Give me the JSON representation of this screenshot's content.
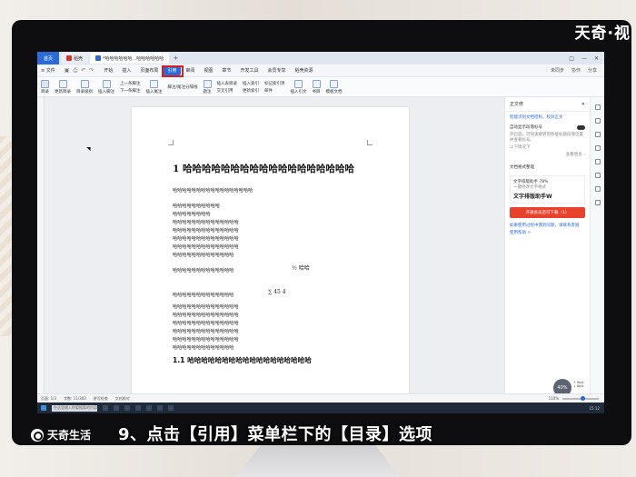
{
  "watermark": "天奇·视",
  "title_bar": {
    "home_tab": "首页",
    "wps_tab": "稻壳",
    "doc_tab": "*哈哈哈哈哈哈...哈哈哈哈哈哈",
    "new_tab": "+",
    "right_icons": [
      "□",
      "—",
      "✕"
    ]
  },
  "menu_bar": {
    "file": "≡ 文件",
    "items": [
      "开始",
      "插入",
      "页面布局",
      "引用",
      "审阅",
      "视图",
      "章节",
      "开发工具",
      "会员专享",
      "稻壳资源"
    ],
    "active": "引用",
    "right": [
      "未同步",
      "协作",
      "分享"
    ]
  },
  "ribbon": {
    "buttons": [
      "目录",
      "更新目录",
      "目录级别",
      "插入脚注",
      "插入尾注"
    ],
    "small_buttons": [
      "上一条脚注",
      "下一条脚注",
      "脚注/尾注分隔线"
    ],
    "more": [
      "题注",
      "插入表目录",
      "交叉引用",
      "插入索引",
      "更新索引",
      "标记索引项",
      "邮件",
      "插入引文",
      "书目",
      "模板文档"
    ]
  },
  "document": {
    "heading1": "1 哈哈哈哈哈哈哈哈哈哈哈哈哈哈哈哈哈哈",
    "lines": [
      "哈哈哈哈哈哈哈哈哈哈哈哈哈哈哈哈哈",
      "哈哈哈哈哈哈哈哈哈哈",
      "哈哈哈哈哈哈哈哈",
      "哈哈哈哈哈哈哈哈哈哈哈哈哈哈",
      "哈哈哈哈哈哈哈哈哈哈哈哈哈哈",
      "哈哈哈哈哈哈哈哈哈哈哈哈哈哈",
      "哈哈哈哈哈哈哈哈哈哈哈哈哈哈",
      "哈哈哈哈哈哈哈哈哈哈哈哈哈"
    ],
    "formula_line": "哈哈哈哈哈哈哈哈哈哈哈哈哈",
    "formula1": "½ 哈哈",
    "formula2_line": "哈哈哈哈哈哈哈哈哈哈哈哈哈",
    "formula2": "∑ 45 4",
    "lines2": [
      "哈哈哈哈哈哈哈哈哈哈哈哈哈哈",
      "哈哈哈哈哈哈哈哈哈哈哈哈哈哈",
      "哈哈哈哈哈哈哈哈哈哈哈哈哈哈",
      "哈哈哈哈哈哈哈哈哈哈哈哈哈哈",
      "哈哈哈哈哈哈哈哈哈哈哈哈哈哈",
      "哈哈哈哈哈哈哈哈哈哈哈哈哈"
    ],
    "heading2": "1.1 哈哈哈哈哈哈哈哈哈哈哈哈哈哈哈哈哈哈"
  },
  "panel": {
    "title": "正文修",
    "close": "✕",
    "subtitle": "智能识别文档结构，校对正文",
    "option": "自动显示段落标号",
    "desc": [
      "开启后，可快速跳转到各级标题段落位置并查看标号。",
      "以下情况下"
    ],
    "link": "查看更多 ›",
    "section": "文档格式整理",
    "card_label": "文字排版助手 78%",
    "card_text": "一键修改文字格式",
    "card_big": "文字排版助手W",
    "button": "开通会员后可下载（1）",
    "note": "如果使用过程中遇到问题，请联系客服",
    "note2": "使用帮助 >"
  },
  "status_bar": {
    "page": "页面: 1/3",
    "words": "字数: 11/383",
    "spell": "拼写检查",
    "doc": "文档校对",
    "zoom": "110%"
  },
  "speed": {
    "value": "40",
    "unit": "%",
    "up": "↑ 0k/s",
    "down": "↓ 0k/s"
  },
  "taskbar": {
    "search": "在这里输入你要搜索的内容",
    "time": "15:12"
  },
  "caption": {
    "logo": "天奇生活",
    "text": "9、点击【引用】菜单栏下的【目录】选项"
  }
}
